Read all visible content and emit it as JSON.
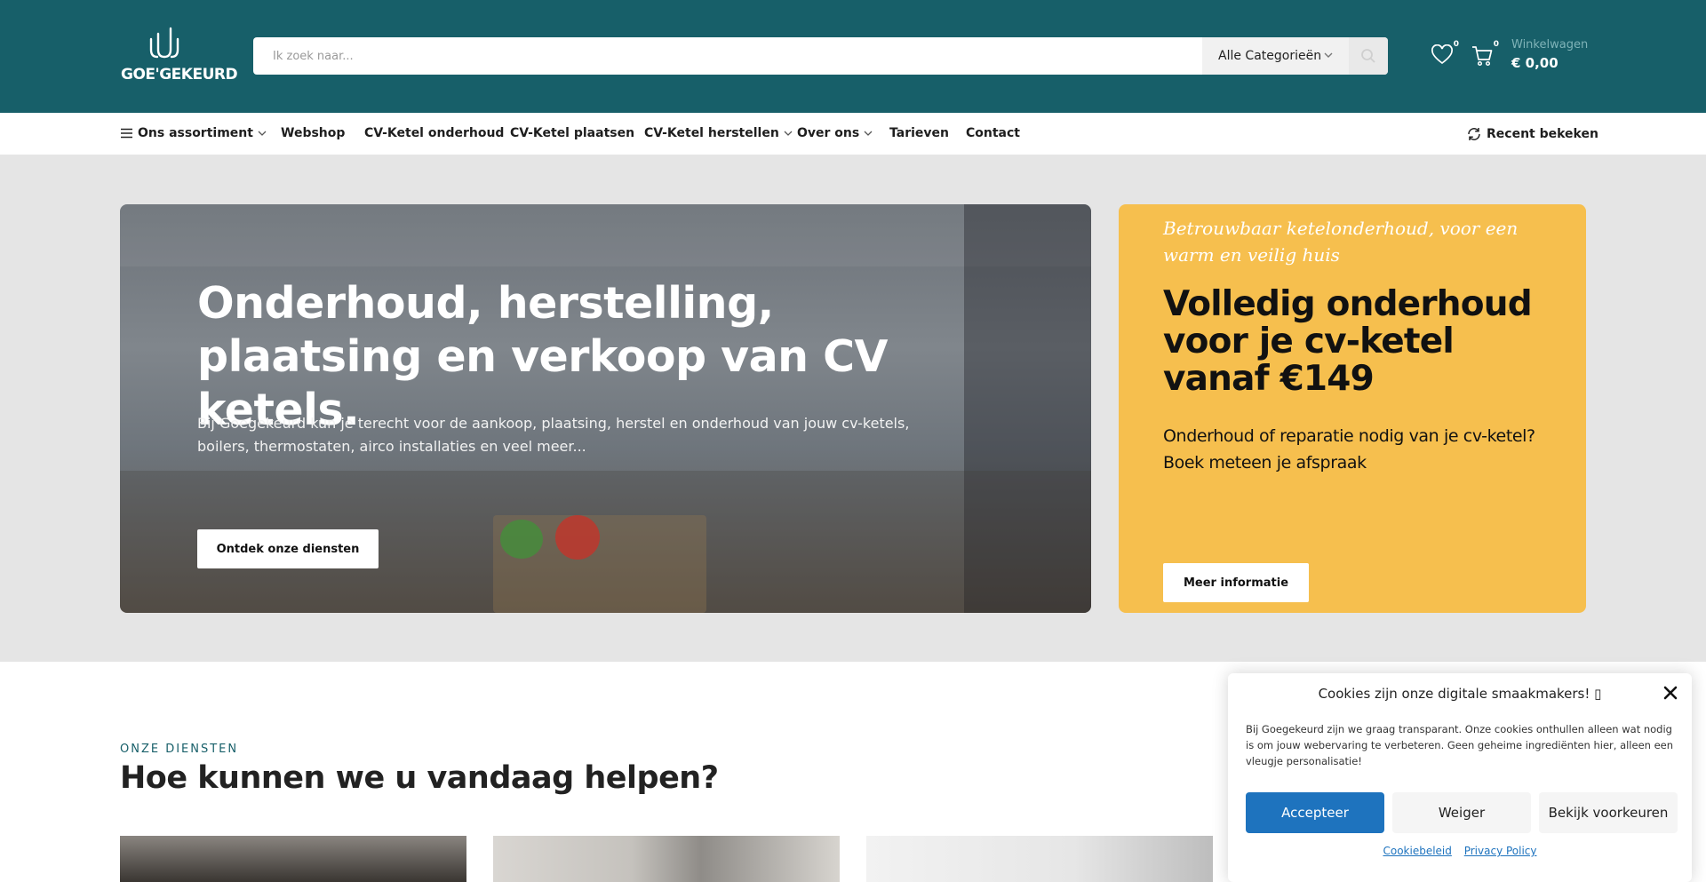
{
  "colors": {
    "header_bg": "#175f69",
    "promo_bg": "#f6bf4e",
    "accept_bg": "#1e73be",
    "hero_bg": "#e5e5e5"
  },
  "header": {
    "logo_text": "GOE'GEKEURD",
    "search": {
      "placeholder": "Ik zoek naar...",
      "category": "Alle Categorieën"
    },
    "wishlist_count": "0",
    "cart_count": "0",
    "cart_label": "Winkelwagen",
    "cart_total": "€ 0,00"
  },
  "nav": {
    "items": [
      {
        "label": "Ons assortiment",
        "icon": "menu-icon",
        "dropdown": true
      },
      {
        "label": "Webshop"
      },
      {
        "label": "CV-Ketel onderhoud"
      },
      {
        "label": "CV-Ketel plaatsen"
      },
      {
        "label": "CV-Ketel herstellen",
        "dropdown": true
      },
      {
        "label": "Over ons",
        "dropdown": true
      },
      {
        "label": "Tarieven"
      },
      {
        "label": "Contact"
      }
    ],
    "recent": "Recent bekeken"
  },
  "hero": {
    "title": "Onderhoud, herstelling, plaatsing en verkoop van CV ketels.",
    "text": "Bij Goegekeurd kun je terecht voor de aankoop, plaatsing, herstel en onderhoud van jouw cv-ketels, boilers, thermostaten, airco installaties en veel meer...",
    "button": "Ontdek onze diensten"
  },
  "promo": {
    "kicker": "Betrouwbaar ketelonderhoud, voor een warm en veilig huis",
    "title": "Volledig onderhoud voor je cv-ketel vanaf €149",
    "text": "Onderhoud of reparatie nodig van je cv-ketel? Boek meteen je afspraak",
    "button": "Meer informatie"
  },
  "services": {
    "kicker": "ONZE DIENSTEN",
    "title": "Hoe kunnen we u vandaag helpen?"
  },
  "cookie": {
    "title": "Cookies zijn onze digitale smaakmakers! ",
    "body": "Bij Goegekeurd zijn we graag transparant. Onze cookies onthullen alleen wat nodig is om jouw webervaring te verbeteren. Geen geheime ingrediënten hier, alleen een vleugje personalisatie!",
    "accept": "Accepteer",
    "deny": "Weiger",
    "prefs": "Bekijk voorkeuren",
    "link_cookie": "Cookiebeleid",
    "link_privacy": "Privacy Policy"
  }
}
